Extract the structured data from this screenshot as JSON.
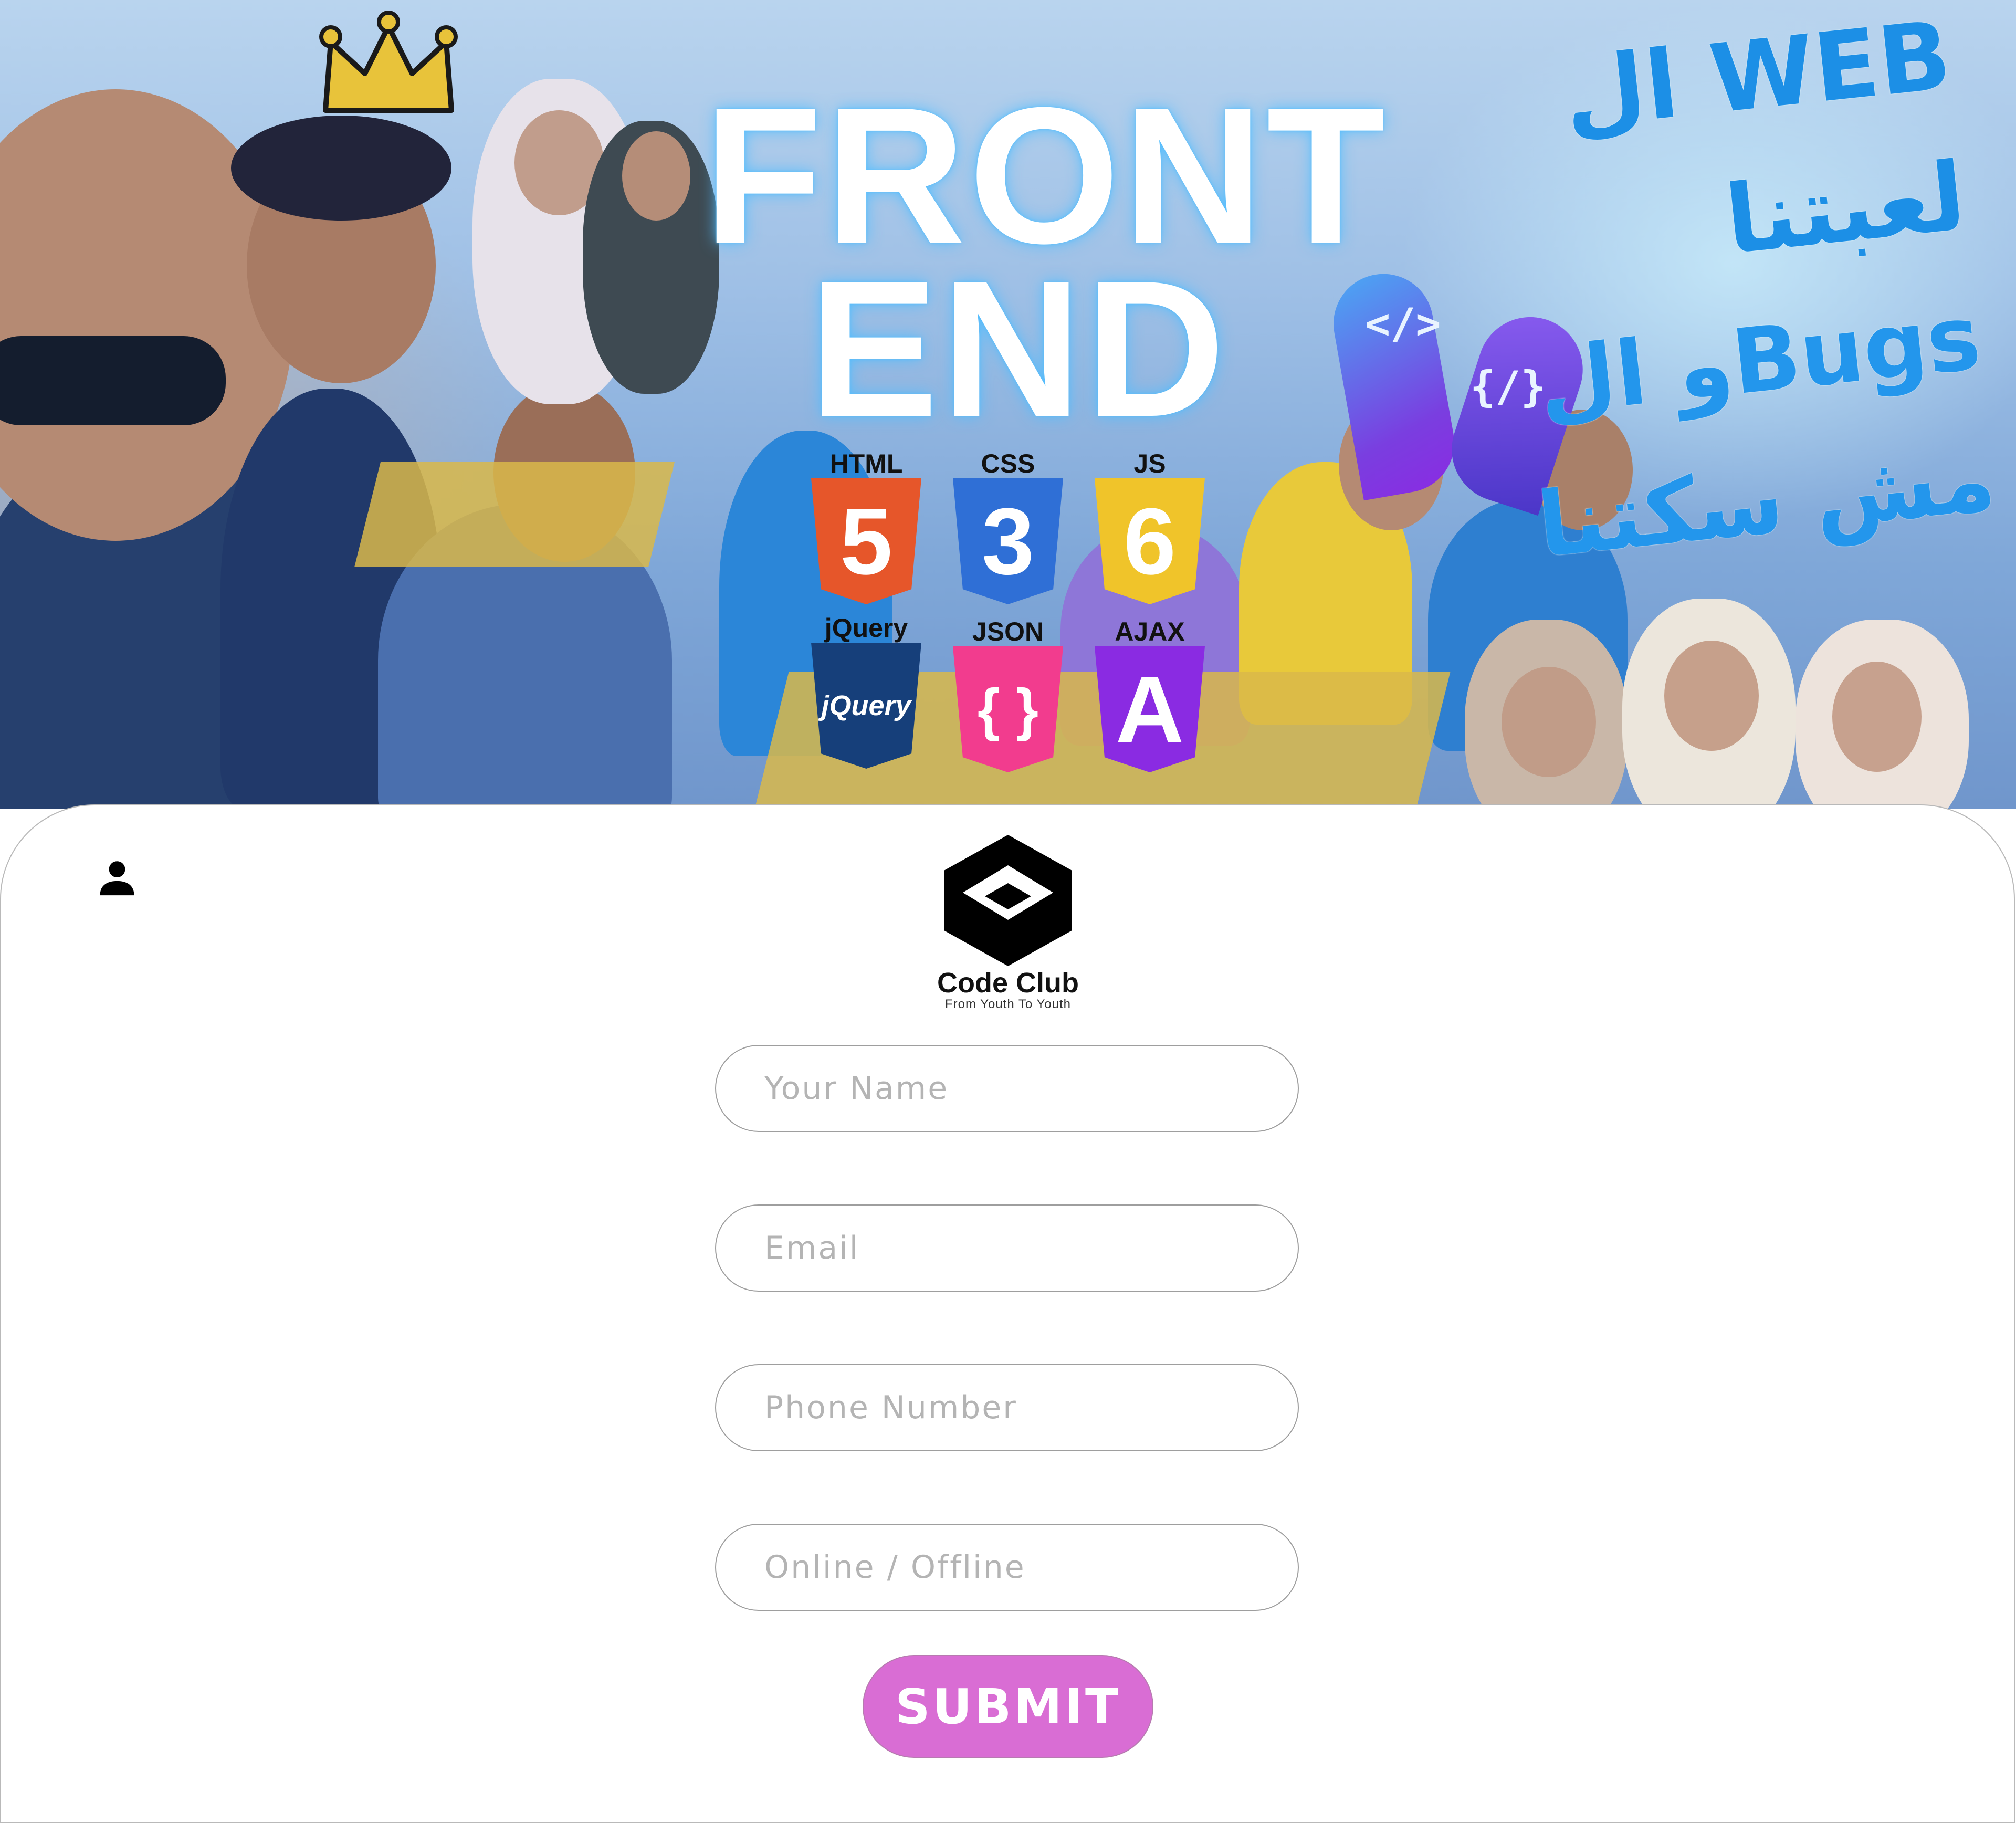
{
  "hero": {
    "title_line1": "FRONT",
    "title_line2": "END",
    "arabic_line1": "ال WEB لعبتنا",
    "arabic_line2": "و الBugs مش سكتنا",
    "bubble_left": "</>",
    "bubble_right": "{/}",
    "badges": [
      {
        "label": "HTML",
        "glyph": "5",
        "color": "#e6562a",
        "icon": "html5-icon"
      },
      {
        "label": "CSS",
        "glyph": "3",
        "color": "#2f6fd6",
        "icon": "css3-icon"
      },
      {
        "label": "JS",
        "glyph": "6",
        "color": "#f0c42a",
        "icon": "js-icon"
      },
      {
        "label": "jQuery",
        "glyph": "jQuery",
        "color": "#163f7a",
        "icon": "jquery-icon"
      },
      {
        "label": "JSON",
        "glyph": "{ }",
        "color": "#f23c8e",
        "icon": "json-icon"
      },
      {
        "label": "AJAX",
        "glyph": "A",
        "color": "#8a2be2",
        "icon": "ajax-icon"
      }
    ]
  },
  "brand": {
    "name": "Code Club",
    "tagline": "From Youth To Youth"
  },
  "form": {
    "name_placeholder": "Your Name",
    "email_placeholder": "Email",
    "phone_placeholder": "Phone Number",
    "mode_placeholder": "Online / Offline",
    "submit_label": "SUBMIT"
  },
  "colors": {
    "submit_bg": "#d96dd4",
    "field_border": "#9e9e9e",
    "title_glow": "#50beff",
    "arabic_text": "#1c8fe6"
  }
}
